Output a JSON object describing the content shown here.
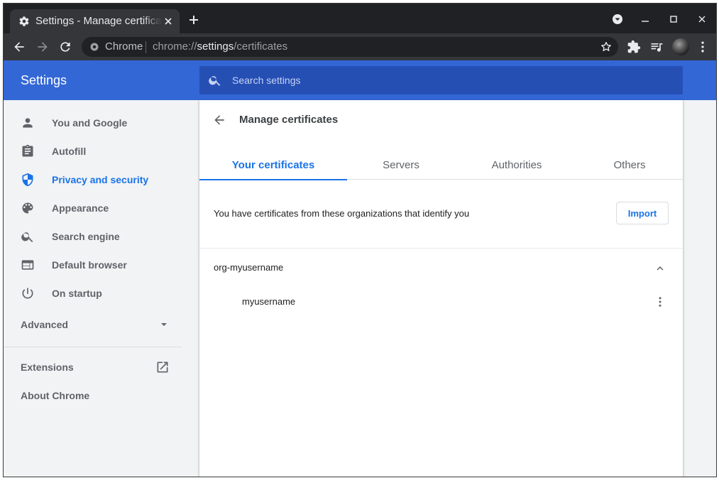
{
  "browser": {
    "tab_title": "Settings - Manage certificates",
    "omnibox": {
      "chip": "Chrome",
      "url_scheme": "chrome://",
      "url_host": "settings",
      "url_path": "/certificates"
    }
  },
  "settings": {
    "title": "Settings",
    "search_placeholder": "Search settings"
  },
  "sidebar": {
    "items": [
      {
        "label": "You and Google",
        "icon": "person-icon"
      },
      {
        "label": "Autofill",
        "icon": "clipboard-icon"
      },
      {
        "label": "Privacy and security",
        "icon": "shield-icon",
        "active": true
      },
      {
        "label": "Appearance",
        "icon": "palette-icon"
      },
      {
        "label": "Search engine",
        "icon": "search-icon"
      },
      {
        "label": "Default browser",
        "icon": "browser-icon"
      },
      {
        "label": "On startup",
        "icon": "power-icon"
      }
    ],
    "advanced_label": "Advanced",
    "extensions_label": "Extensions",
    "about_label": "About Chrome"
  },
  "page": {
    "title": "Manage certificates",
    "tabs": [
      {
        "label": "Your certificates",
        "active": true
      },
      {
        "label": "Servers"
      },
      {
        "label": "Authorities"
      },
      {
        "label": "Others"
      }
    ],
    "intro_text": "You have certificates from these organizations that identify you",
    "import_label": "Import",
    "organization": "org-myusername",
    "certificate": "myusername"
  },
  "colors": {
    "accent": "#1a73e8",
    "header_blue": "#3367d6",
    "search_blue": "#264fb4",
    "titlebar": "#202124",
    "toolbar": "#35363a"
  }
}
